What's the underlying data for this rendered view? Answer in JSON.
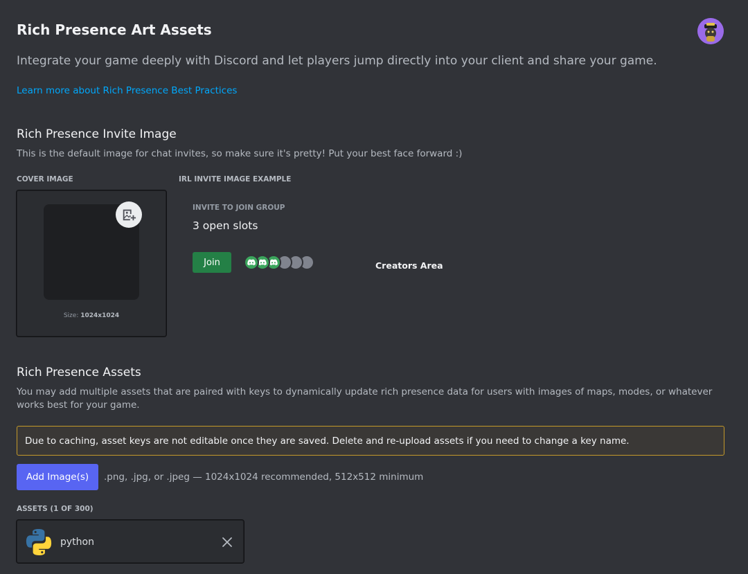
{
  "header": {
    "title": "Rich Presence Art Assets",
    "description": "Integrate your game deeply with Discord and let players jump directly into your client and share your game.",
    "learn_more_link": "Learn more about Rich Presence Best Practices",
    "avatar_icon": "user-avatar-icon"
  },
  "invite_image": {
    "title": "Rich Presence Invite Image",
    "description": "This is the default image for chat invites, so make sure it's pretty! Put your best face forward :)",
    "cover_label": "COVER IMAGE",
    "example_label": "IRL INVITE IMAGE EXAMPLE",
    "size_prefix": "Size:",
    "size_value": "1024x1024",
    "upload_icon": "add-image-icon",
    "example": {
      "eyebrow": "INVITE TO JOIN GROUP",
      "slots_text": "3 open slots",
      "join_label": "Join",
      "filled_slots": 3,
      "total_slots": 6,
      "creators_area": "Creators Area"
    }
  },
  "assets": {
    "title": "Rich Presence Assets",
    "description": "You may add multiple assets that are paired with keys to dynamically update rich presence data for users with images of maps, modes, or whatever works best for your game.",
    "warning": "Due to caching, asset keys are not editable once they are saved. Delete and re-upload assets if you need to change a key name.",
    "add_button": "Add Image(s)",
    "add_hint": ".png, .jpg, or .jpeg — 1024x1024 recommended, 512x512 minimum",
    "count_label": "ASSETS (1 OF 300)",
    "items": [
      {
        "name": "python",
        "icon": "python-logo-icon",
        "remove_icon": "close-icon"
      }
    ]
  },
  "colors": {
    "background": "#313338",
    "link": "#00a8fc",
    "join_green": "#248046",
    "blurple": "#5865f2",
    "warning_border": "#c49a2a"
  }
}
